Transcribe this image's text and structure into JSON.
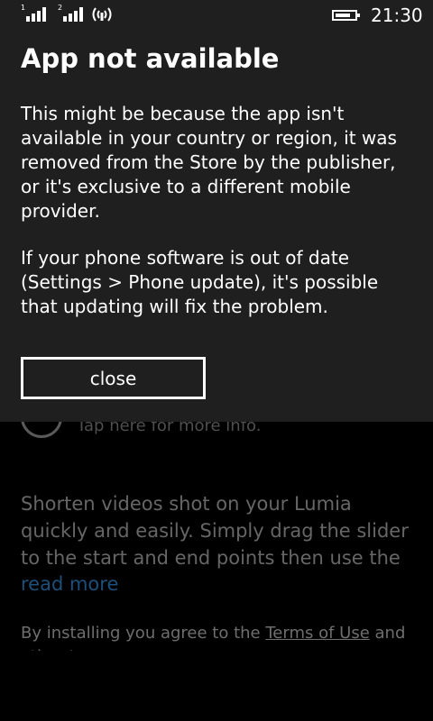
{
  "status_bar": {
    "sim1_label": "1",
    "sim2_label": "2",
    "signal_icon": "signal-strength-icon",
    "wifi_icon": "wifi-icon",
    "battery_icon": "battery-icon",
    "battery_level": 0.8,
    "time": "21:30"
  },
  "dialog": {
    "title": "App not available",
    "paragraph1": "This might be because the app isn't available in your country or region, it was removed from the Store by the publisher, or it's exclusive to a different mobile provider.",
    "paragraph2": "If your phone software is out of date (Settings > Phone update), it's possible that updating will fix the problem.",
    "close_label": "close"
  },
  "background": {
    "info_icon": "info-icon",
    "info_text": "Tap here for more info.",
    "description": "Shorten videos shot on your Lumia quickly and easily. Simply drag the slider to the start and end points then use the step controls",
    "read_more": "read more",
    "terms_prefix": "By installing you agree to the ",
    "terms_link": "Terms of Use",
    "terms_suffix": " and other terms"
  },
  "colors": {
    "dialog_bg": "#1f1f1f",
    "page_bg": "#000000",
    "link": "#1c4f7a"
  }
}
